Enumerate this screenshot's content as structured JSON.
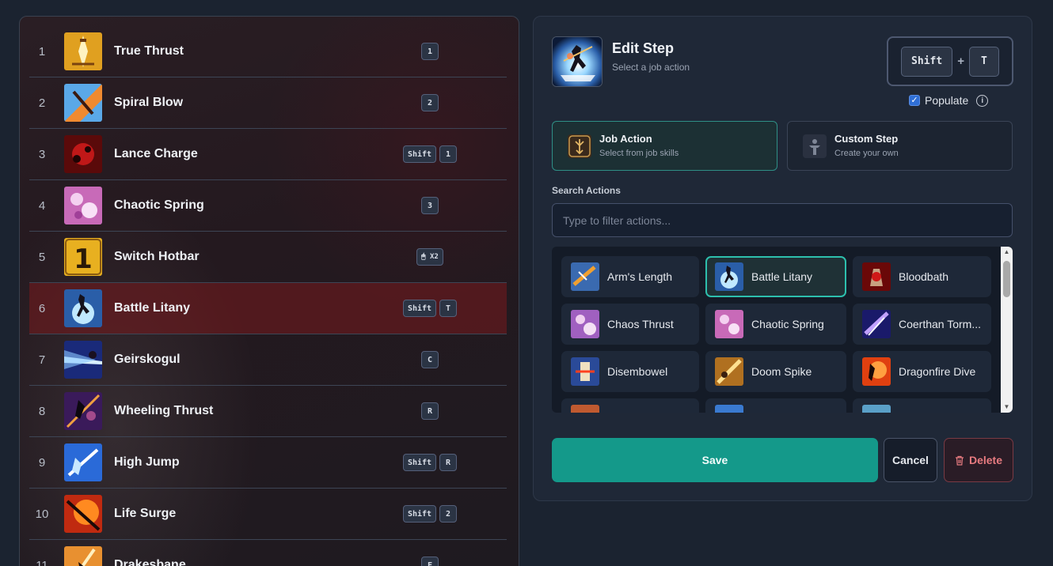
{
  "rotation": {
    "steps": [
      {
        "num": "1",
        "name": "True Thrust",
        "keys": [
          "1"
        ]
      },
      {
        "num": "2",
        "name": "Spiral Blow",
        "keys": [
          "2"
        ]
      },
      {
        "num": "3",
        "name": "Lance Charge",
        "keys": [
          "Shift",
          "1"
        ]
      },
      {
        "num": "4",
        "name": "Chaotic Spring",
        "keys": [
          "3"
        ]
      },
      {
        "num": "5",
        "name": "Switch Hotbar",
        "keys": [
          "🖱 X2"
        ]
      },
      {
        "num": "6",
        "name": "Battle Litany",
        "keys": [
          "Shift",
          "T"
        ],
        "selected": true
      },
      {
        "num": "7",
        "name": "Geirskogul",
        "keys": [
          "C"
        ]
      },
      {
        "num": "8",
        "name": "Wheeling Thrust",
        "keys": [
          "R"
        ]
      },
      {
        "num": "9",
        "name": "High Jump",
        "keys": [
          "Shift",
          "R"
        ]
      },
      {
        "num": "10",
        "name": "Life Surge",
        "keys": [
          "Shift",
          "2"
        ]
      },
      {
        "num": "11",
        "name": "Drakesbane",
        "keys": [
          "F"
        ]
      }
    ]
  },
  "edit": {
    "title": "Edit Step",
    "subtitle": "Select a job action",
    "hotkey": {
      "modifier": "Shift",
      "plus": "+",
      "key": "T"
    },
    "populate_label": "Populate",
    "populate_checked": true,
    "modes": {
      "job": {
        "title": "Job Action",
        "subtitle": "Select from job skills"
      },
      "custom": {
        "title": "Custom Step",
        "subtitle": "Create your own"
      }
    },
    "search": {
      "label": "Search Actions",
      "placeholder": "Type to filter actions..."
    },
    "actions": [
      {
        "name": "Arm's Length"
      },
      {
        "name": "Battle Litany",
        "selected": true
      },
      {
        "name": "Bloodbath"
      },
      {
        "name": "Chaos Thrust"
      },
      {
        "name": "Chaotic Spring"
      },
      {
        "name": "Coerthan Torm..."
      },
      {
        "name": "Disembowel"
      },
      {
        "name": "Doom Spike"
      },
      {
        "name": "Dragonfire Dive"
      }
    ],
    "buttons": {
      "save": "Save",
      "cancel": "Cancel",
      "delete": "Delete"
    }
  },
  "colors": {
    "accent": "#14998a",
    "selected_row": "#781e22",
    "danger": "#e77b80"
  }
}
